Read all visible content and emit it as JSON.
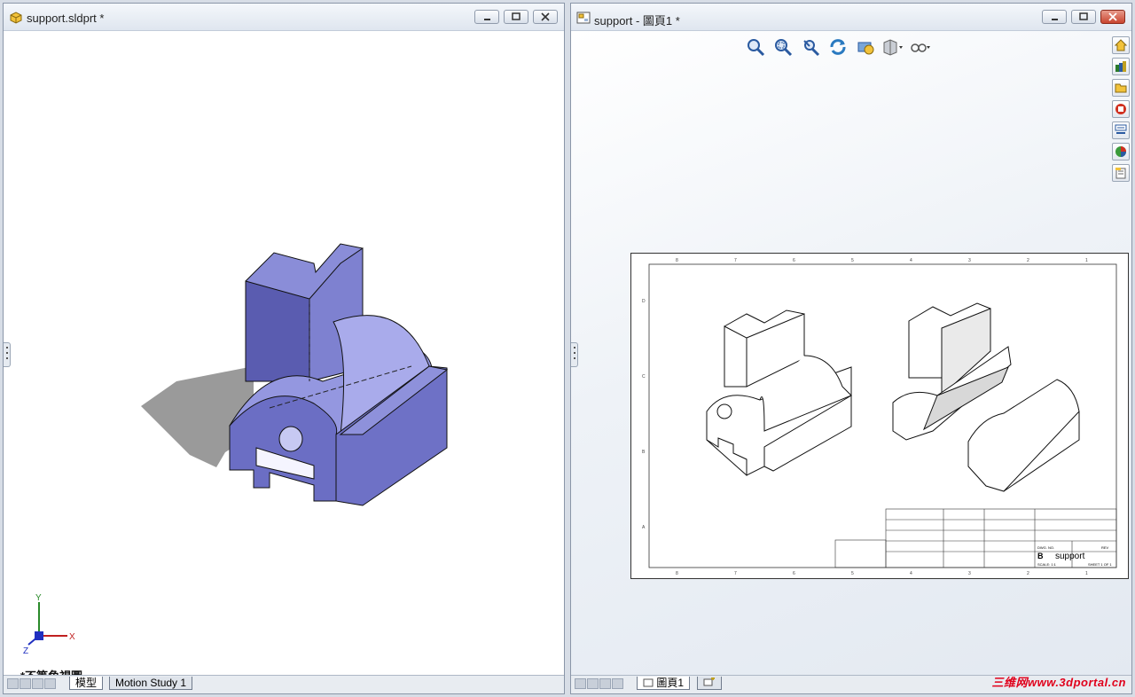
{
  "left_window": {
    "title": "support.sldprt *",
    "view_label": "*不等角視圖",
    "tabs": [
      "模型",
      "Motion Study 1"
    ],
    "triad": {
      "x": "X",
      "y": "Y",
      "z": "Z"
    },
    "colors": {
      "part": "#6f72c8",
      "shadow": "#9a9a9a"
    }
  },
  "right_window": {
    "title": "support - 圖頁1 *",
    "tabs": [
      "圖頁1"
    ],
    "hud_icons": [
      "zoom-to-fit-icon",
      "zoom-area-icon",
      "previous-view-icon",
      "rotate-icon",
      "pan-icon",
      "display-style-icon",
      "hide-show-icon"
    ],
    "task_pane_icons": [
      "home-icon",
      "design-library-icon",
      "file-explorer-icon",
      "view-palette-icon",
      "appearances-icon",
      "custom-properties-icon",
      "document-recovery-icon"
    ],
    "title_block": {
      "size": "B",
      "dwg_no_label": "DWG. NO.",
      "dwg_no": "support",
      "rev_label": "REV",
      "scale_label": "SCALE: 1:1",
      "sheet_label": "SHEET 1 OF 1"
    },
    "border_numbers": [
      "8",
      "7",
      "6",
      "5",
      "4",
      "3",
      "2",
      "1"
    ],
    "border_letters": [
      "D",
      "C",
      "B",
      "A"
    ]
  },
  "watermark": "三维网www.3dportal.cn"
}
